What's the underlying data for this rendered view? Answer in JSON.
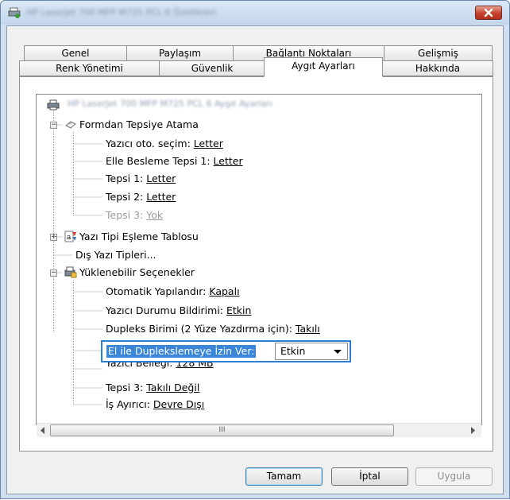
{
  "window": {
    "title": "HP LaserJet 700 MFP M725 PCL 6 Özellikleri"
  },
  "tabs_top": [
    {
      "label": "Genel"
    },
    {
      "label": "Paylaşım"
    },
    {
      "label": "Bağlantı Noktaları"
    },
    {
      "label": "Gelişmiş"
    }
  ],
  "tabs_bottom": [
    {
      "label": "Renk Yönetimi"
    },
    {
      "label": "Güvenlik"
    },
    {
      "label": "Aygıt Ayarları"
    },
    {
      "label": "Hakkında"
    }
  ],
  "active_tab": "Aygıt Ayarları",
  "tree": {
    "root": "HP LaserJet 700 MFP M725 PCL 6 Aygıt Ayarları",
    "form_to_tray": {
      "label": "Formdan Tepsiye Atama",
      "items": [
        {
          "label": "Yazıcı oto. seçim: ",
          "value": "Letter"
        },
        {
          "label": "Elle Besleme Tepsi 1: ",
          "value": "Letter"
        },
        {
          "label": "Tepsi 1: ",
          "value": "Letter"
        },
        {
          "label": "Tepsi 2: ",
          "value": "Letter"
        },
        {
          "label": "Tepsi 3: ",
          "value": "Yok"
        }
      ]
    },
    "font_table": {
      "label": "Yazı Tipi Eşleme Tablosu"
    },
    "external_fonts": {
      "label": "Dış Yazı Tipleri..."
    },
    "installable": {
      "label": "Yüklenebilir Seçenekler",
      "items": [
        {
          "label": "Otomatik Yapılandır: ",
          "value": "Kapalı"
        },
        {
          "label": "Yazıcı Durumu Bildirimi: ",
          "value": "Etkin"
        },
        {
          "label": "Dupleks Birimi (2 Yüze Yazdırma için): ",
          "value": "Takılı"
        },
        {
          "label": "Yazıcı Belleği: ",
          "value": "128 MB"
        },
        {
          "label": "Tepsi 3: ",
          "value": "Takılı Değil"
        },
        {
          "label": "İş Ayırıcı: ",
          "value": "Devre Dışı"
        }
      ],
      "highlighted": {
        "label": "El ile Dupleks­lemeye İzin Ver:",
        "value": "Etkin"
      }
    }
  },
  "scrollbar": {
    "grip": "III"
  },
  "buttons": {
    "ok": "Tamam",
    "cancel": "İptal",
    "apply": "Uygula"
  }
}
